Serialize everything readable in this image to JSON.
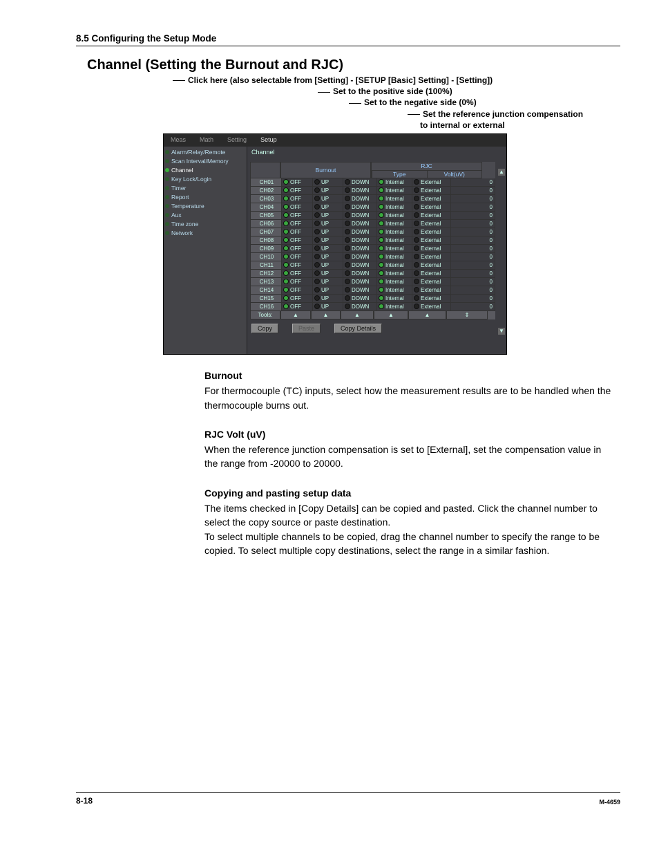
{
  "page": {
    "section_header": "8.5  Configuring the Setup Mode",
    "main_title": "Channel (Setting the Burnout and RJC)",
    "page_number": "8-18",
    "doc_id": "M-4659"
  },
  "annotations": {
    "l1": "Click here (also selectable from [Setting] - [SETUP [Basic] Setting] - [Setting])",
    "l2": "Set to the positive side (100%)",
    "l3": "Set to the negative side (0%)",
    "l4": "Set the reference junction compensation",
    "l4b": "to internal or external"
  },
  "ui": {
    "tabs": [
      "Meas",
      "Math",
      "Setting",
      "Setup"
    ],
    "sidebar": [
      "Alarm/Relay/Remote",
      "Scan Interval/Memory",
      "Channel",
      "Key Lock/Login",
      "Timer",
      "Report",
      "Temperature",
      "Aux",
      "Time zone",
      "Network"
    ],
    "sidebar_selected": 2,
    "panel_tab": "Channel",
    "head_burnout": "Burnout",
    "head_rjc": "RJC",
    "head_type": "Type",
    "head_volt": "Volt(uV)",
    "labels": {
      "off": "OFF",
      "up": "UP",
      "down": "DOWN",
      "internal": "Internal",
      "external": "External",
      "volt": "0"
    },
    "channels": [
      "CH01",
      "CH02",
      "CH03",
      "CH04",
      "CH05",
      "CH06",
      "CH07",
      "CH08",
      "CH09",
      "CH10",
      "CH11",
      "CH12",
      "CH13",
      "CH14",
      "CH15",
      "CH16"
    ],
    "tools_label": "Tools:",
    "btn_copy": "Copy",
    "btn_paste": "Paste",
    "btn_copydetails": "Copy Details"
  },
  "body": {
    "h_burnout": "Burnout",
    "p_burnout": "For thermocouple (TC) inputs, select how the measurement results are to be handled when the thermocouple burns out.",
    "h_rjc": "RJC  Volt (uV)",
    "p_rjc": "When the reference junction compensation is set to [External], set the compensation value in the range from -20000 to 20000.",
    "h_copy": "Copying and pasting setup data",
    "p_copy1": "The items checked in [Copy Details] can be copied and pasted.  Click the channel number to select the copy source or paste destination.",
    "p_copy2": "To select multiple channels to be copied, drag the channel number to specify the range to be copied.  To select multiple copy destinations, select the range in a similar fashion."
  }
}
